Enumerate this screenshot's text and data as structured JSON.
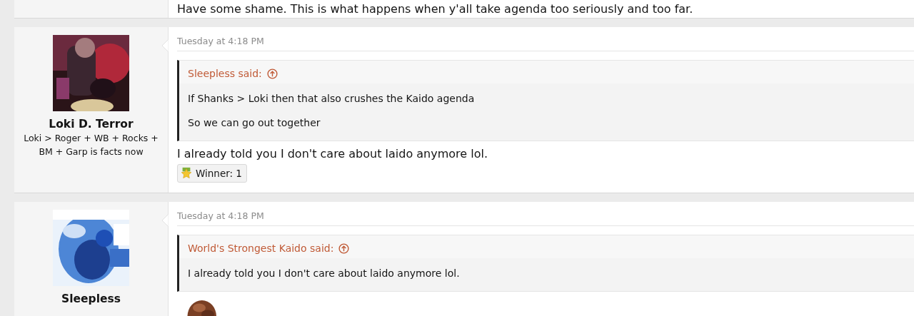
{
  "previous_post": {
    "message": "Have some shame. This is what happens when y'all take agenda too seriously and too far."
  },
  "posts": [
    {
      "author": {
        "name": "Loki D. Terror",
        "title": "Loki > Roger + WB + Rocks + BM + Garp is facts now"
      },
      "time": "Tuesday at 4:18 PM",
      "quote": {
        "header": "Sleepless said:",
        "lines": [
          "If Shanks > Loki then that also crushes the Kaido agenda",
          "So we can go out together"
        ]
      },
      "message": "I already told you I don't care about laido anymore lol.",
      "reactions": [
        {
          "label": "Winner: 1"
        }
      ]
    },
    {
      "author": {
        "name": "Sleepless"
      },
      "time": "Tuesday at 4:18 PM",
      "quote": {
        "header": "World's Strongest Kaido said:",
        "lines": [
          "I already told you I don't care about laido anymore lol."
        ]
      }
    }
  ]
}
